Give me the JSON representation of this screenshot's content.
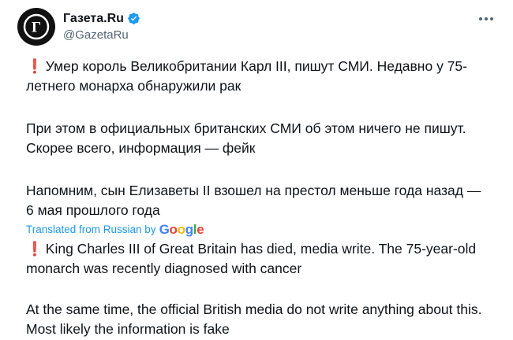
{
  "account": {
    "display_name": "Газета.Ru",
    "handle": "@GazetaRu",
    "avatar_letter": "Г"
  },
  "tweet": {
    "ru_paragraphs": [
      {
        "prefix": "❗",
        "text": "Умер король Великобритании Карл III, пишут СМИ. Недавно у 75-летнего монарха обнаружили рак"
      },
      {
        "prefix": "",
        "text": "При этом в официальных британских СМИ об этом ничего не пишут. Скорее всего, информация — фейк"
      },
      {
        "prefix": "",
        "text": "Напомним, сын Елизаветы II взошел на престол меньше года назад — 6 мая прошлого года"
      }
    ],
    "translated_label": "Translated from Russian by",
    "translator_brand": "Google",
    "en_paragraphs": [
      {
        "prefix": "❗",
        "text": "King Charles III of Great Britain has died, media write. The 75-year-old monarch was recently diagnosed with cancer"
      },
      {
        "prefix": "",
        "text": "At the same time, the official British media do not write anything about this. Most likely the information is fake"
      }
    ]
  },
  "colors": {
    "text": "#0f1419",
    "secondary": "#536471",
    "link": "#1d9bf0",
    "verified": "#1d9bf0",
    "exclamation": "#e0245e"
  },
  "icons": {
    "verified": "verified-badge-icon",
    "more": "more-options-icon",
    "avatar": "gazeta-logo-icon"
  }
}
